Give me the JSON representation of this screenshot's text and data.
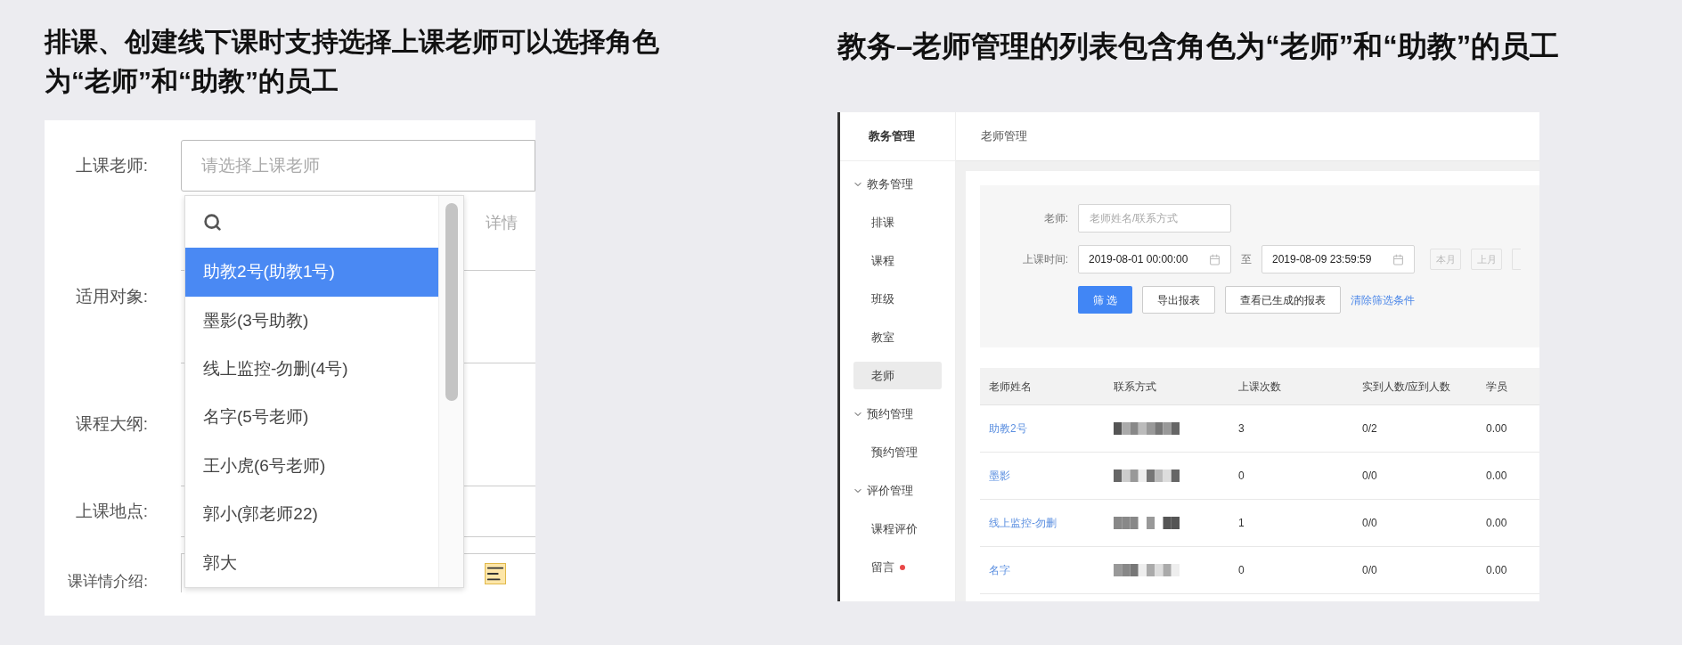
{
  "left": {
    "title": "排课、创建线下课时支持选择上课老师可以选择角色为“老师”和“助教”的员工",
    "form": {
      "teacher_label": "上课老师:",
      "teacher_placeholder": "请选择上课老师",
      "hint": "详情",
      "labels": [
        "适用对象:",
        "课程大纲:",
        "上课地点:",
        "课详情介绍:"
      ]
    },
    "dropdown": {
      "items": [
        {
          "label": "助教2号(助教1号)",
          "selected": true
        },
        {
          "label": "墨影(3号助教)",
          "selected": false
        },
        {
          "label": "线上监控-勿删(4号)",
          "selected": false
        },
        {
          "label": "名字(5号老师)",
          "selected": false
        },
        {
          "label": "王小虎(6号老师)",
          "selected": false
        },
        {
          "label": "郭小(郭老师22)",
          "selected": false
        },
        {
          "label": "郭大",
          "selected": false
        }
      ]
    }
  },
  "right": {
    "title": "教务–老师管理的列表包含角色为“老师”和“助教”的员工",
    "sidebar": {
      "header": "教务管理",
      "groups": [
        {
          "label": "教务管理",
          "expanded": true,
          "children": [
            {
              "label": "排课",
              "selected": false,
              "unread": false
            },
            {
              "label": "课程",
              "selected": false,
              "unread": false
            },
            {
              "label": "班级",
              "selected": false,
              "unread": false
            },
            {
              "label": "教室",
              "selected": false,
              "unread": false
            },
            {
              "label": "老师",
              "selected": true,
              "unread": false
            }
          ]
        },
        {
          "label": "预约管理",
          "expanded": true,
          "children": [
            {
              "label": "预约管理",
              "selected": false,
              "unread": false
            }
          ]
        },
        {
          "label": "评价管理",
          "expanded": true,
          "children": [
            {
              "label": "课程评价",
              "selected": false,
              "unread": false
            },
            {
              "label": "留言",
              "selected": false,
              "unread": true
            }
          ]
        }
      ]
    },
    "breadcrumb": "老师管理",
    "filter": {
      "teacher_label": "老师:",
      "teacher_placeholder": "老师姓名/联系方式",
      "time_label": "上课时间:",
      "start": "2019-08-01 00:00:00",
      "to": "至",
      "end": "2019-08-09 23:59:59",
      "quick": [
        "本月",
        "上月"
      ],
      "buttons": [
        {
          "label": "筛 选",
          "kind": "primary"
        },
        {
          "label": "导出报表",
          "kind": "default"
        },
        {
          "label": "查看已生成的报表",
          "kind": "default"
        },
        {
          "label": "清除筛选条件",
          "kind": "link"
        }
      ]
    },
    "table": {
      "columns": [
        "老师姓名",
        "联系方式",
        "上课次数",
        "实到人数/应到人数",
        "学员"
      ],
      "rows": [
        {
          "name": "助教2号",
          "count": "3",
          "attendance": "0/2",
          "column_5": "0.00"
        },
        {
          "name": "墨影",
          "count": "0",
          "attendance": "0/0",
          "column_5": "0.00"
        },
        {
          "name": "线上监控-勿删",
          "count": "1",
          "attendance": "0/0",
          "column_5": "0.00"
        },
        {
          "name": "名字",
          "count": "0",
          "attendance": "0/0",
          "column_5": "0.00"
        }
      ]
    }
  }
}
